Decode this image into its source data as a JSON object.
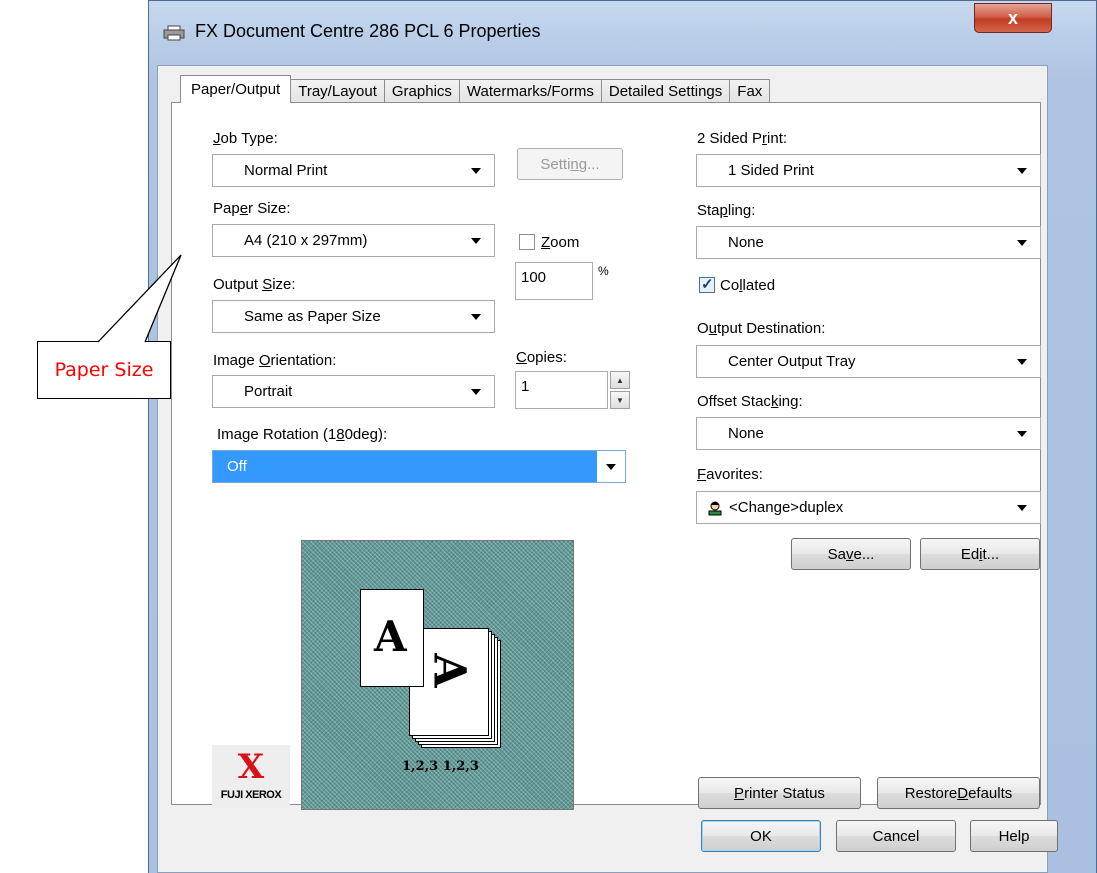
{
  "annotation": {
    "label": "Paper Size"
  },
  "window": {
    "title": "FX Document Centre 286 PCL 6 Properties",
    "close_glyph": "x"
  },
  "tabs": [
    {
      "label": "Paper/Output",
      "active": true
    },
    {
      "label": "Tray/Layout"
    },
    {
      "label": "Graphics"
    },
    {
      "label": "Watermarks/Forms"
    },
    {
      "label": "Detailed Settings"
    },
    {
      "label": "Fax"
    }
  ],
  "left": {
    "job_type": {
      "label_pre": "",
      "label_key": "J",
      "label_post": "ob Type:",
      "value": "Normal Print"
    },
    "setting_button": {
      "pre": "Setti",
      "key": "n",
      "post": "g..."
    },
    "paper_size": {
      "label_pre": "Pap",
      "label_key": "e",
      "label_post": "r Size:",
      "value": "A4 (210 x 297mm)"
    },
    "zoom": {
      "pre": "",
      "key": "Z",
      "post": "oom",
      "value": "100",
      "unit": "%"
    },
    "output_size": {
      "label_pre": "Output ",
      "label_key": "S",
      "label_post": "ize:",
      "value": "Same as Paper Size"
    },
    "image_orientation": {
      "label_pre": "Image ",
      "label_key": "O",
      "label_post": "rientation:",
      "value": "Portrait"
    },
    "copies": {
      "label_pre": "",
      "label_key": "C",
      "label_post": "opies:",
      "value": "1"
    },
    "image_rotation": {
      "label_pre": "Image Rotation (1",
      "label_key": "8",
      "label_post": "0deg):",
      "value": "Off"
    },
    "preview": {
      "glyph": "A",
      "caption": "1,2,3  1,2,3"
    },
    "logo": {
      "mark": "X",
      "text": "FUJI XEROX"
    }
  },
  "right": {
    "two_sided": {
      "label_pre": "2 Sided P",
      "label_key": "r",
      "label_post": "int:",
      "value": "1 Sided Print"
    },
    "stapling": {
      "label_pre": "Sta",
      "label_key": "p",
      "label_post": "ling:",
      "value": "None"
    },
    "collated": {
      "pre": "Co",
      "key": "l",
      "post": "lated",
      "checked": true
    },
    "output_destination": {
      "label_pre": "O",
      "label_key": "u",
      "label_post": "tput Destination:",
      "value": "Center Output Tray"
    },
    "offset_stacking": {
      "label_pre": "Offset Stac",
      "label_key": "k",
      "label_post": "ing:",
      "value": "None"
    },
    "favorites": {
      "label_pre": "",
      "label_key": "F",
      "label_post": "avorites:",
      "value": "<Change>duplex"
    },
    "save_button": {
      "pre": "Sa",
      "key": "v",
      "post": "e..."
    },
    "edit_button": {
      "pre": "Ed",
      "key": "i",
      "post": "t..."
    },
    "printer_status_button": {
      "pre": "",
      "key": "P",
      "post": "rinter Status"
    },
    "restore_defaults_button": {
      "pre": "Restore ",
      "key": "D",
      "post": "efaults"
    }
  },
  "footer": {
    "ok": "OK",
    "cancel": "Cancel",
    "help": "Help"
  }
}
